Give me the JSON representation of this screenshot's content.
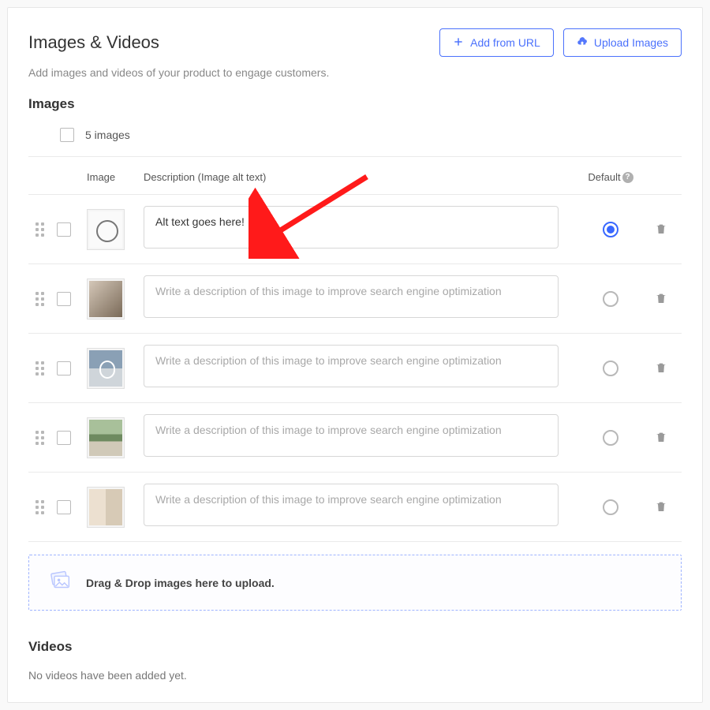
{
  "header": {
    "title": "Images & Videos",
    "subtext": "Add images and videos of your product to engage customers.",
    "add_from_url": "Add from URL",
    "upload_images": "Upload Images"
  },
  "images_section": {
    "heading": "Images",
    "count_text": "5 images",
    "columns": {
      "image": "Image",
      "description": "Description (Image alt text)",
      "default": "Default"
    },
    "placeholder": "Write a description of this image to improve search engine optimization",
    "rows": [
      {
        "alt_value": "Alt text goes here!",
        "is_default": true
      },
      {
        "alt_value": "",
        "is_default": false
      },
      {
        "alt_value": "",
        "is_default": false
      },
      {
        "alt_value": "",
        "is_default": false
      },
      {
        "alt_value": "",
        "is_default": false
      }
    ],
    "dropzone_text": "Drag & Drop images here to upload."
  },
  "videos_section": {
    "heading": "Videos",
    "empty_text": "No videos have been added yet."
  }
}
